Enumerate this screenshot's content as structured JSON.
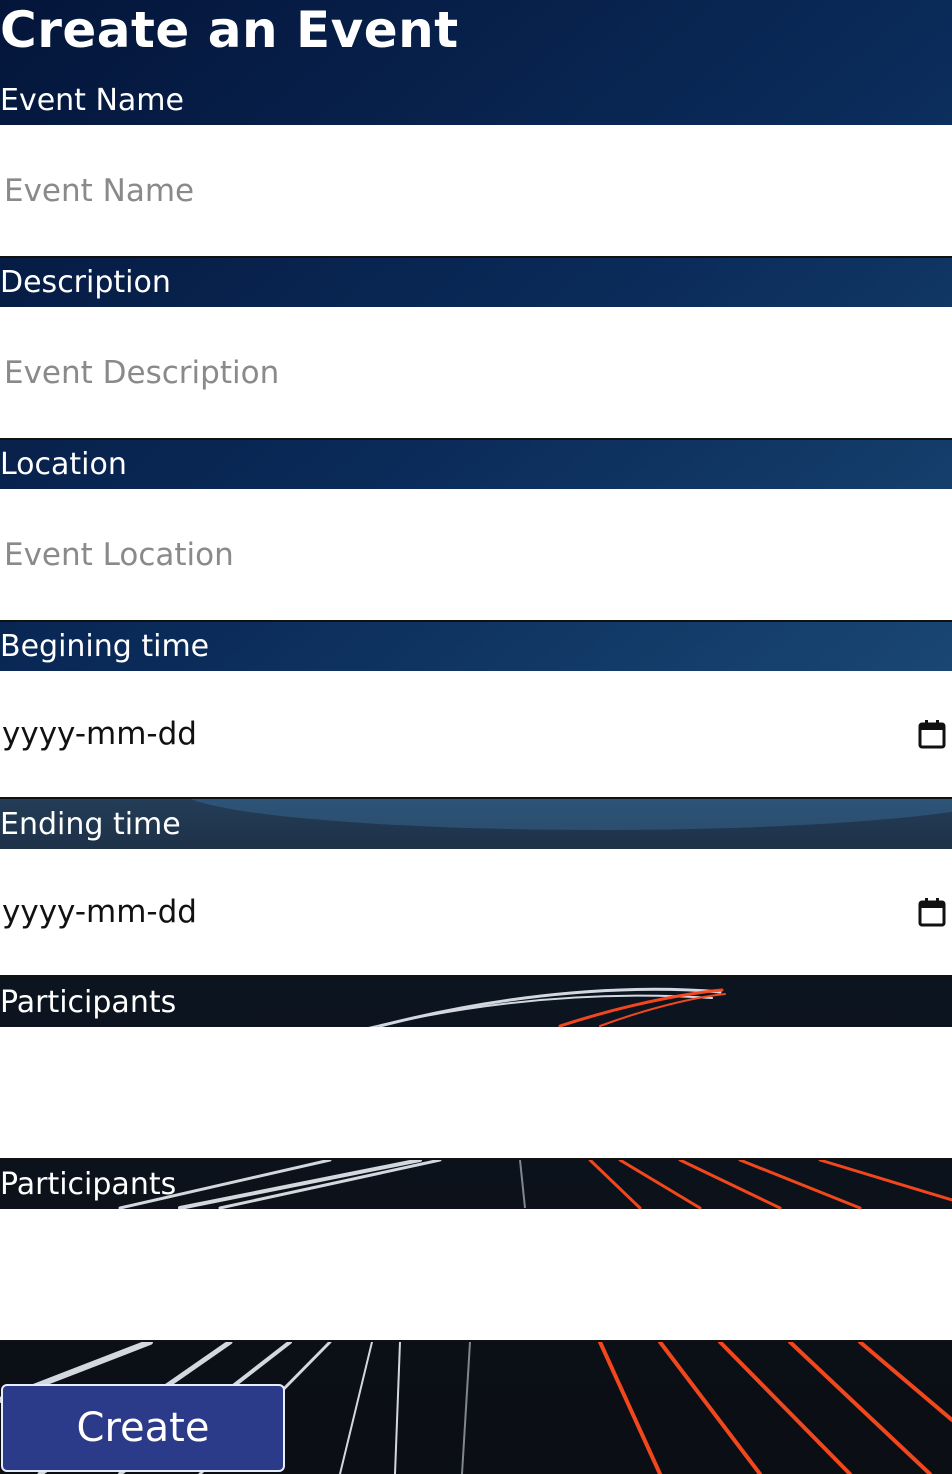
{
  "form": {
    "title": "Create an Event",
    "fields": [
      {
        "label": "Event Name",
        "placeholder": "Event Name",
        "value": ""
      },
      {
        "label": "Description",
        "placeholder": "Event Description",
        "value": ""
      },
      {
        "label": "Location",
        "placeholder": "Event Location",
        "value": ""
      },
      {
        "label": "Begining time",
        "display": "yyyy-mm-dd",
        "icon": "calendar-icon"
      },
      {
        "label": "Ending time",
        "display": "yyyy-mm-dd",
        "icon": "calendar-icon"
      },
      {
        "label": "Participants",
        "value": ""
      },
      {
        "label": "Participants",
        "value": ""
      }
    ],
    "submit_label": "Create"
  },
  "colors": {
    "button_bg": "#2c3a8a",
    "background_top": "#04153a",
    "input_bg": "#ffffff",
    "placeholder": "#8a8a8a"
  }
}
